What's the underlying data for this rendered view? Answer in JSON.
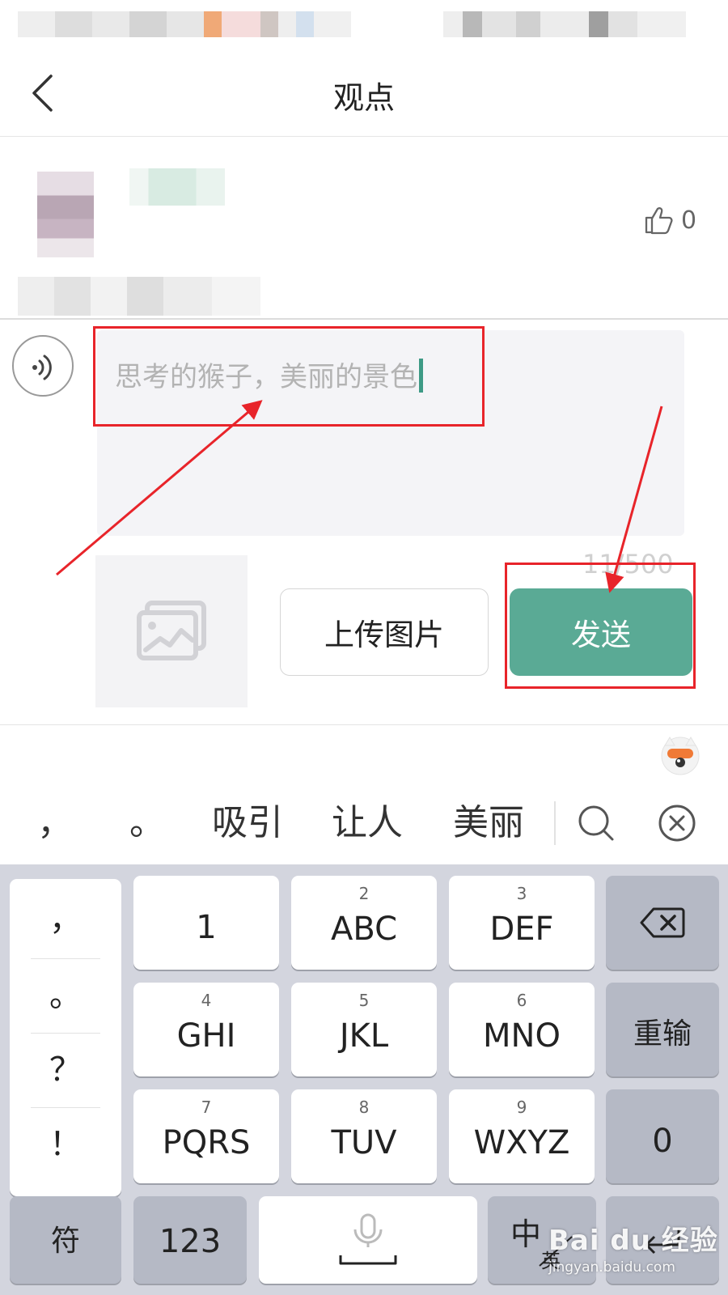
{
  "nav": {
    "title": "观点"
  },
  "comment": {
    "like_count": "0"
  },
  "composer": {
    "input_value": "思考的猴子，美丽的景色",
    "char_count": "11/500",
    "upload_label": "上传图片",
    "send_label": "发送"
  },
  "ime": {
    "candidates": [
      "，",
      "。",
      "吸引",
      "让人",
      "美丽"
    ]
  },
  "keyboard": {
    "punct": [
      "，",
      "。",
      "？",
      "！"
    ],
    "row1": [
      {
        "num": "",
        "label": "1"
      },
      {
        "num": "2",
        "label": "ABC"
      },
      {
        "num": "3",
        "label": "DEF"
      }
    ],
    "row2": [
      {
        "num": "4",
        "label": "GHI"
      },
      {
        "num": "5",
        "label": "JKL"
      },
      {
        "num": "6",
        "label": "MNO"
      }
    ],
    "row3": [
      {
        "num": "7",
        "label": "PQRS"
      },
      {
        "num": "8",
        "label": "TUV"
      },
      {
        "num": "9",
        "label": "WXYZ"
      }
    ],
    "retype_label": "重输",
    "zero_label": "0",
    "symbol_label": "符",
    "numeric_label": "123",
    "lang_label": "中",
    "lang_alt_label": "英"
  },
  "watermark": {
    "logo": "Bai du 经验",
    "url": "jingyan.baidu.com"
  },
  "colors": {
    "accent": "#5aaa95",
    "cursor": "#3d9a85",
    "annotation": "#e8242a"
  }
}
